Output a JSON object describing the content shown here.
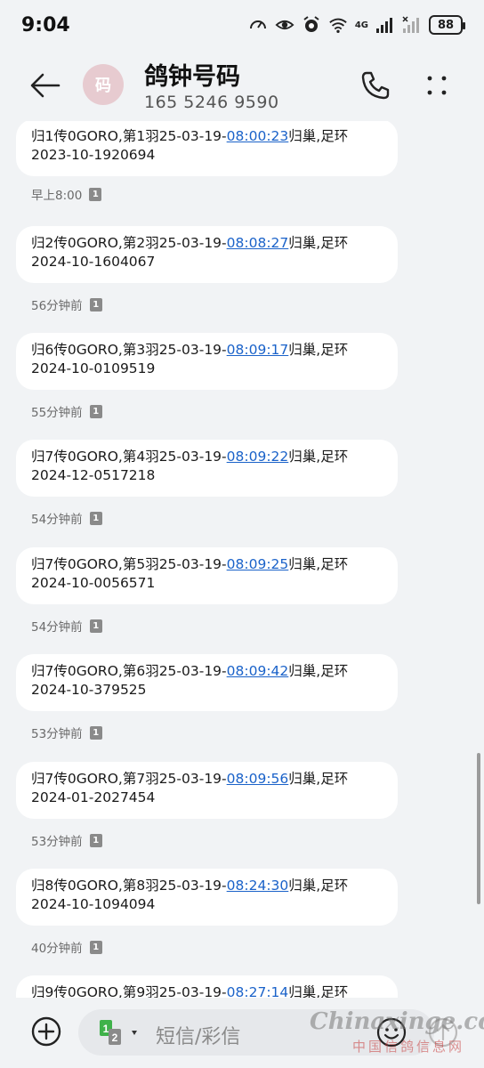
{
  "status_bar": {
    "time": "9:04",
    "network": "4G",
    "battery": "88",
    "icons": [
      "speed-icon",
      "eye-icon",
      "alarm-icon",
      "wifi-icon",
      "signal-icon",
      "signal-2-icon",
      "battery-icon"
    ]
  },
  "header": {
    "avatar_text": "码",
    "contact_name": "鸽钟号码",
    "contact_number": "165 5246 9590",
    "icons": [
      "back-arrow-icon",
      "phone-icon",
      "more-dots-icon"
    ]
  },
  "messages": [
    {
      "line1_before": "归1传0GORO,第1羽25-03-19-",
      "time_link": "08:00:23",
      "line1_after": "归巢,足环",
      "line2": "2023-10-1920694",
      "meta": "早上8:00",
      "sim": "1"
    },
    {
      "line1_before": "归2传0GORO,第2羽25-03-19-",
      "time_link": "08:08:27",
      "line1_after": "归巢,足环",
      "line2": "2024-10-1604067",
      "meta": "56分钟前",
      "sim": "1"
    },
    {
      "line1_before": "归6传0GORO,第3羽25-03-19-",
      "time_link": "08:09:17",
      "line1_after": "归巢,足环",
      "line2": "2024-10-0109519",
      "meta": "55分钟前",
      "sim": "1"
    },
    {
      "line1_before": "归7传0GORO,第4羽25-03-19-",
      "time_link": "08:09:22",
      "line1_after": "归巢,足环",
      "line2": "2024-12-0517218",
      "meta": "54分钟前",
      "sim": "1"
    },
    {
      "line1_before": "归7传0GORO,第5羽25-03-19-",
      "time_link": "08:09:25",
      "line1_after": "归巢,足环",
      "line2": "2024-10-0056571",
      "meta": "54分钟前",
      "sim": "1"
    },
    {
      "line1_before": "归7传0GORO,第6羽25-03-19-",
      "time_link": "08:09:42",
      "line1_after": "归巢,足环",
      "line2": "2024-10-379525",
      "meta": "53分钟前",
      "sim": "1"
    },
    {
      "line1_before": "归7传0GORO,第7羽25-03-19-",
      "time_link": "08:09:56",
      "line1_after": "归巢,足环",
      "line2": "2024-01-2027454",
      "meta": "53分钟前",
      "sim": "1"
    },
    {
      "line1_before": "归8传0GORO,第8羽25-03-19-",
      "time_link": "08:24:30",
      "line1_after": "归巢,足环",
      "line2": "2024-10-1094094",
      "meta": "40分钟前",
      "sim": "1"
    },
    {
      "line1_before": "归9传0GORO,第9羽25-03-19-",
      "time_link": "08:27:14",
      "line1_after": "归巢,足环",
      "line2": "",
      "meta": "",
      "sim": ""
    }
  ],
  "input_bar": {
    "placeholder": "短信/彩信",
    "sim_primary": "1",
    "sim_secondary": "2",
    "icons": [
      "add-circle-icon",
      "sim-select-icon",
      "emoji-icon",
      "send-icon"
    ]
  },
  "watermark": {
    "main": "Chinaxinge.com",
    "sub": "中国信鸽信息网"
  },
  "colors": {
    "background": "#f1f3f5",
    "bubble": "#ffffff",
    "link": "#1a62c9",
    "avatar": "#e7cbd0",
    "sim_primary": "#3fb24a"
  }
}
